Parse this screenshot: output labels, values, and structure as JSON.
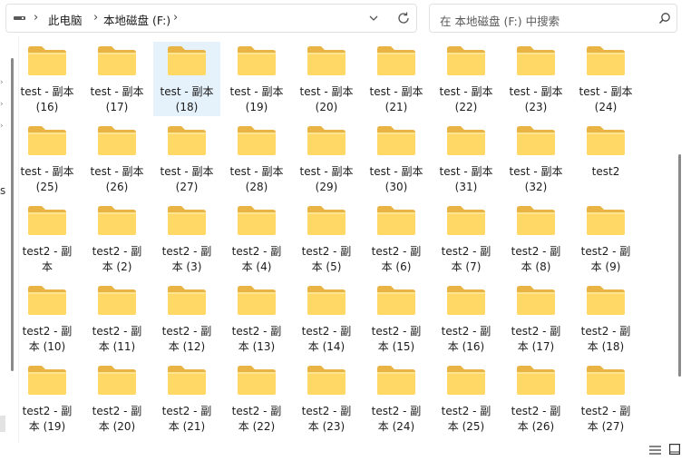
{
  "address": {
    "breadcrumbs": [
      "此电脑",
      "本地磁盘 (F:)"
    ],
    "separator": "›"
  },
  "search": {
    "placeholder": "在 本地磁盘 (F:) 中搜索"
  },
  "navpane": {
    "partial_text": "s"
  },
  "colors": {
    "folder_front": "#FFD865",
    "folder_back": "#E9B443",
    "selection": "#E5F1FB"
  },
  "items": [
    {
      "label": "test - 副本\n(16)"
    },
    {
      "label": "test - 副本\n(17)"
    },
    {
      "label": "test - 副本\n(18)",
      "selected": true
    },
    {
      "label": "test - 副本\n(19)"
    },
    {
      "label": "test - 副本\n(20)"
    },
    {
      "label": "test - 副本\n(21)"
    },
    {
      "label": "test - 副本\n(22)"
    },
    {
      "label": "test - 副本\n(23)"
    },
    {
      "label": "test - 副本\n(24)"
    },
    {
      "label": "test - 副本\n(25)"
    },
    {
      "label": "test - 副本\n(26)"
    },
    {
      "label": "test - 副本\n(27)"
    },
    {
      "label": "test - 副本\n(28)"
    },
    {
      "label": "test - 副本\n(29)"
    },
    {
      "label": "test - 副本\n(30)"
    },
    {
      "label": "test - 副本\n(31)"
    },
    {
      "label": "test - 副本\n(32)"
    },
    {
      "label": "test2"
    },
    {
      "label": "test2 - 副\n本"
    },
    {
      "label": "test2 - 副\n本 (2)"
    },
    {
      "label": "test2 - 副\n本 (3)"
    },
    {
      "label": "test2 - 副\n本 (4)"
    },
    {
      "label": "test2 - 副\n本 (5)"
    },
    {
      "label": "test2 - 副\n本 (6)"
    },
    {
      "label": "test2 - 副\n本 (7)"
    },
    {
      "label": "test2 - 副\n本 (8)"
    },
    {
      "label": "test2 - 副\n本 (9)"
    },
    {
      "label": "test2 - 副\n本 (10)"
    },
    {
      "label": "test2 - 副\n本 (11)"
    },
    {
      "label": "test2 - 副\n本 (12)"
    },
    {
      "label": "test2 - 副\n本 (13)"
    },
    {
      "label": "test2 - 副\n本 (14)"
    },
    {
      "label": "test2 - 副\n本 (15)"
    },
    {
      "label": "test2 - 副\n本 (16)"
    },
    {
      "label": "test2 - 副\n本 (17)"
    },
    {
      "label": "test2 - 副\n本 (18)"
    },
    {
      "label": "test2 - 副\n本 (19)"
    },
    {
      "label": "test2 - 副\n本 (20)"
    },
    {
      "label": "test2 - 副\n本 (21)"
    },
    {
      "label": "test2 - 副\n本 (22)"
    },
    {
      "label": "test2 - 副\n本 (23)"
    },
    {
      "label": "test2 - 副\n本 (24)"
    },
    {
      "label": "test2 - 副\n本 (25)"
    },
    {
      "label": "test2 - 副\n本 (26)"
    },
    {
      "label": "test2 - 副\n本 (27)"
    }
  ]
}
